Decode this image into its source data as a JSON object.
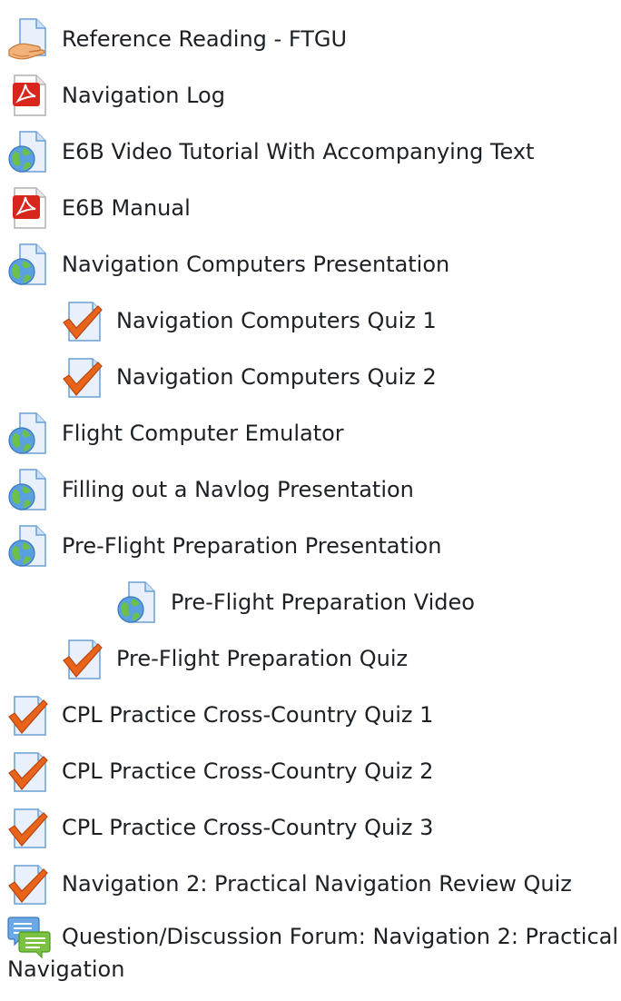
{
  "activities": [
    {
      "label": "Reference Reading - FTGU",
      "icon": "page-hand-icon",
      "indent": 0
    },
    {
      "label": "Navigation Log",
      "icon": "pdf-icon",
      "indent": 0
    },
    {
      "label": "E6B Video Tutorial With Accompanying Text",
      "icon": "url-globe-icon",
      "indent": 0
    },
    {
      "label": "E6B Manual",
      "icon": "pdf-icon",
      "indent": 0
    },
    {
      "label": "Navigation Computers Presentation",
      "icon": "url-globe-icon",
      "indent": 0
    },
    {
      "label": "Navigation Computers Quiz 1",
      "icon": "quiz-check-icon",
      "indent": 1
    },
    {
      "label": "Navigation Computers Quiz 2",
      "icon": "quiz-check-icon",
      "indent": 1
    },
    {
      "label": "Flight Computer Emulator",
      "icon": "url-globe-icon",
      "indent": 0
    },
    {
      "label": "Filling out a Navlog Presentation",
      "icon": "url-globe-icon",
      "indent": 0
    },
    {
      "label": "Pre-Flight Preparation Presentation",
      "icon": "url-globe-icon",
      "indent": 0
    },
    {
      "label": "Pre-Flight Preparation Video",
      "icon": "url-globe-icon",
      "indent": 2
    },
    {
      "label": "Pre-Flight Preparation Quiz",
      "icon": "quiz-check-icon",
      "indent": 1
    },
    {
      "label": "CPL Practice Cross-Country Quiz 1",
      "icon": "quiz-check-icon",
      "indent": 0
    },
    {
      "label": "CPL Practice Cross-Country Quiz 2",
      "icon": "quiz-check-icon",
      "indent": 0
    },
    {
      "label": "CPL Practice Cross-Country Quiz 3",
      "icon": "quiz-check-icon",
      "indent": 0
    },
    {
      "label": "Navigation 2: Practical Navigation Review Quiz",
      "icon": "quiz-check-icon",
      "indent": 0
    }
  ],
  "forum": {
    "label_line1": "Question/Discussion Forum: Navigation 2: Practical",
    "label_line2": "Navigation",
    "icon": "forum-speech-icon"
  },
  "colors": {
    "text": "#1d2125",
    "page_blue": "#7fb3e0",
    "pdf_red": "#d9261c",
    "check_orange": "#e8641b",
    "globe_green": "#4caf50",
    "forum_green": "#7cc242"
  }
}
